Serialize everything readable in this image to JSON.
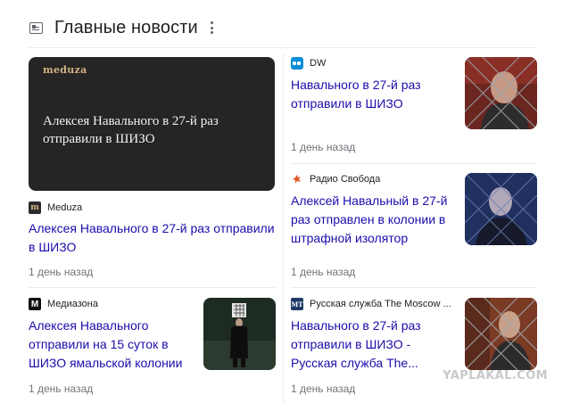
{
  "header": {
    "title": "Главные новости",
    "icon": "newspaper-icon",
    "menu_icon": "more-vert-icon"
  },
  "featured": {
    "image": {
      "logo_text": "meduza",
      "headline_text": "Алексея Навального в 27-й раз отправили в ШИЗО"
    },
    "source": "Meduza",
    "headline": "Алексея Навального в 27-й раз отправили в ШИЗО",
    "time": "1 день назад"
  },
  "cards": [
    {
      "source": "DW",
      "headline": "Навального в 27-й раз отправили в ШИЗО",
      "time": "1 день назад",
      "logo_letter": ""
    },
    {
      "source": "Радио Свобода",
      "headline": "Алексей Навальный в 27-й раз отправлен в колонии в штрафной изолятор",
      "time": "1 день назад",
      "logo_letter": ""
    },
    {
      "source": "Медиазона",
      "headline": "Алексея Навального отправили на 15 суток в ШИЗО ямальской колонии",
      "time": "1 день назад",
      "logo_letter": "М"
    },
    {
      "source": "Русская служба The Moscow ...",
      "headline": "Навального в 27-й раз отправили в ШИЗО - Русская служба The...",
      "time": "1 день назад",
      "logo_letter": "MT"
    }
  ],
  "watermark": "YAPLAKAL.COM",
  "colors": {
    "link": "#1a0dab",
    "meta": "#70757a",
    "divider": "#ebebeb"
  }
}
